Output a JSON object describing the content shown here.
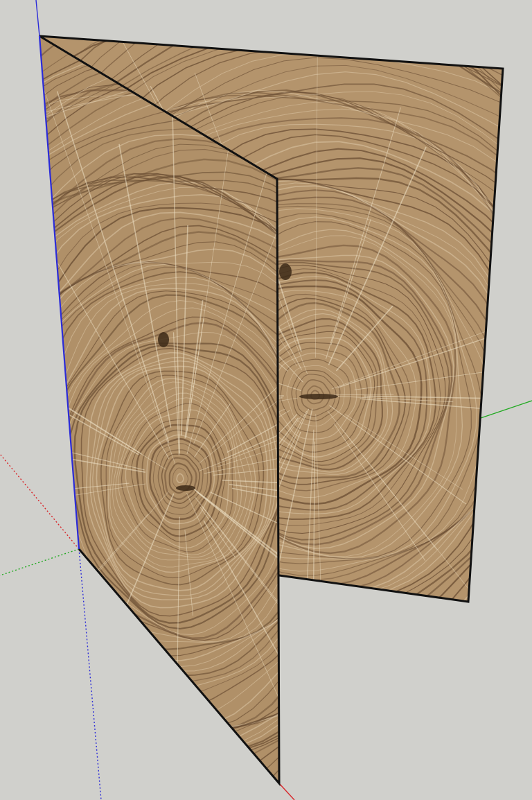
{
  "viewport": {
    "background_color": "#d0d0cc"
  },
  "axes": {
    "x_axis_color": "#d8262a",
    "y_axis_color": "#22aa22",
    "z_axis_color": "#2b2bd8"
  },
  "panels": [
    {
      "name": "back-panel",
      "material": "wood-end-grain",
      "edge_color": "#111111"
    },
    {
      "name": "front-panel",
      "material": "wood-end-grain",
      "edge_color": "#111111"
    }
  ],
  "wood": {
    "base_color": "#b4946c",
    "ring_dark_color": "#6b4e33",
    "ring_light_color": "#dcc7a5",
    "ray_color": "#efe2c6",
    "knot_color": "#3d2a18"
  }
}
